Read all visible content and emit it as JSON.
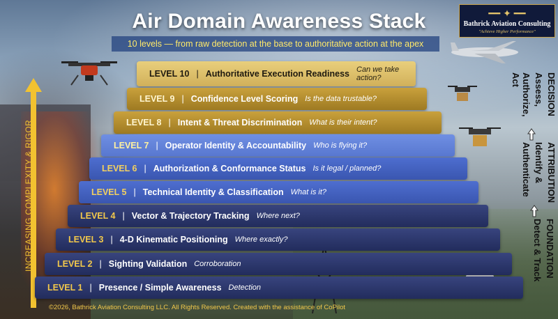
{
  "title": "Air Domain Awareness Stack",
  "subtitle": "10 levels — from raw detection at the base to authoritative action at the apex",
  "logo": {
    "name": "Bathrick Aviation Consulting",
    "tagline": "\"Achieve Higher Performance\""
  },
  "axis_label": "INCREASING COMPLEXITY & RIGOR",
  "levels": [
    {
      "level": "LEVEL 10",
      "title": "Authoritative Execution Readiness",
      "question": "Can we take action?"
    },
    {
      "level": "LEVEL 9",
      "title": "Confidence Level Scoring",
      "question": "Is the data trustable?"
    },
    {
      "level": "LEVEL 8",
      "title": "Intent & Threat Discrimination",
      "question": "What is their intent?"
    },
    {
      "level": "LEVEL 7",
      "title": "Operator Identity & Accountability",
      "question": "Who is flying it?"
    },
    {
      "level": "LEVEL 6",
      "title": "Authorization & Conformance Status",
      "question": "Is it legal / planned?"
    },
    {
      "level": "LEVEL 5",
      "title": "Technical Identity & Classification",
      "question": "What is it?"
    },
    {
      "level": "LEVEL 4",
      "title": "Vector & Trajectory Tracking",
      "question": "Where next?"
    },
    {
      "level": "LEVEL 3",
      "title": "4-D Kinematic Positioning",
      "question": "Where exactly?"
    },
    {
      "level": "LEVEL 2",
      "title": "Sighting Validation",
      "question": "Corroboration"
    },
    {
      "level": "LEVEL 1",
      "title": "Presence / Simple Awareness",
      "question": "Detection"
    }
  ],
  "side_labels": {
    "decision": {
      "heading": "DECISION",
      "line1": "Assess,",
      "line2": "Authorize, Act"
    },
    "attribution": {
      "heading": "ATTRIBUTION",
      "line1": "Identify &",
      "line2": "Authenticate"
    },
    "foundation": {
      "heading": "FOUNDATION",
      "line1": "Detect & Track"
    }
  },
  "copyright": "©2026, Bathrick Aviation Consulting LLC. All Rights Reserved. Created with the assistance of CoPilot",
  "colors": {
    "accent_gold": "#f2c230",
    "navy": "#222c5c",
    "blue": "#3a56b0",
    "gold": "#c9a13c"
  }
}
